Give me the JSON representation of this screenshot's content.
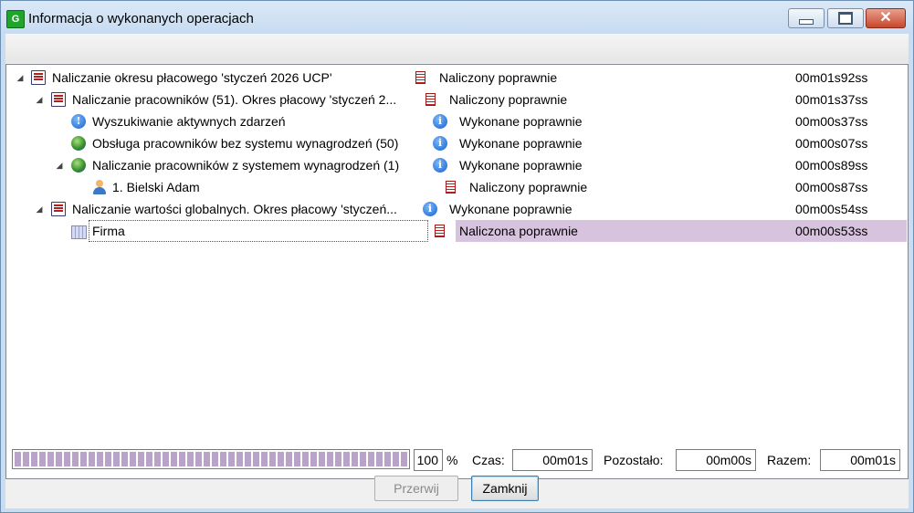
{
  "window": {
    "title": "Informacja o wykonanych operacjach",
    "app_icon": "G"
  },
  "tree": {
    "rows": [
      {
        "name": "Naliczanie okresu płacowego 'styczeń 2026 UCP'",
        "status": "Naliczony poprawnie",
        "time": "00m01s92ss",
        "icon": "document-icon",
        "status_icon": "calc-status-icon"
      },
      {
        "name": "Naliczanie pracowników (51). Okres płacowy 'styczeń 2...",
        "status": "Naliczony poprawnie",
        "time": "00m01s37ss",
        "icon": "document-icon",
        "status_icon": "calc-status-icon"
      },
      {
        "name": "Wyszukiwanie aktywnych zdarzeń",
        "status": "Wykonane poprawnie",
        "time": "00m00s37ss",
        "icon": "info-circle-icon",
        "status_icon": "info-icon"
      },
      {
        "name": "Obsługa pracowników bez systemu wynagrodzeń (50)",
        "status": "Wykonane poprawnie",
        "time": "00m00s07ss",
        "icon": "globe-icon",
        "status_icon": "info-icon"
      },
      {
        "name": "Naliczanie pracowników z systemem wynagrodzeń (1)",
        "status": "Wykonane poprawnie",
        "time": "00m00s89ss",
        "icon": "globe-icon",
        "status_icon": "info-icon"
      },
      {
        "name": "1. Bielski Adam",
        "status": "Naliczony poprawnie",
        "time": "00m00s87ss",
        "icon": "user-icon",
        "status_icon": "calc-status-icon"
      },
      {
        "name": "Naliczanie wartości globalnych. Okres płacowy 'styczeń...",
        "status": "Wykonane poprawnie",
        "time": "00m00s54ss",
        "icon": "document-icon",
        "status_icon": "info-icon"
      },
      {
        "name": "Firma",
        "status": "Naliczona poprawnie",
        "time": "00m00s53ss",
        "icon": "building-icon",
        "status_icon": "calc-status-icon"
      }
    ]
  },
  "footer": {
    "progress_value": "100",
    "progress_fraction": 1.0,
    "percent_sign": "%",
    "czas_label": "Czas:",
    "czas_value": "00m01s",
    "pozostalo_label": "Pozostało:",
    "pozostalo_value": "00m00s",
    "razem_label": "Razem:",
    "razem_value": "00m01s",
    "przerwij_label": "Przerwij",
    "zamknij_label": "Zamknij"
  },
  "colors": {
    "selection": "#d8c3df",
    "progress": "#b9a3c9",
    "titlebar": "#c7dbf1"
  }
}
